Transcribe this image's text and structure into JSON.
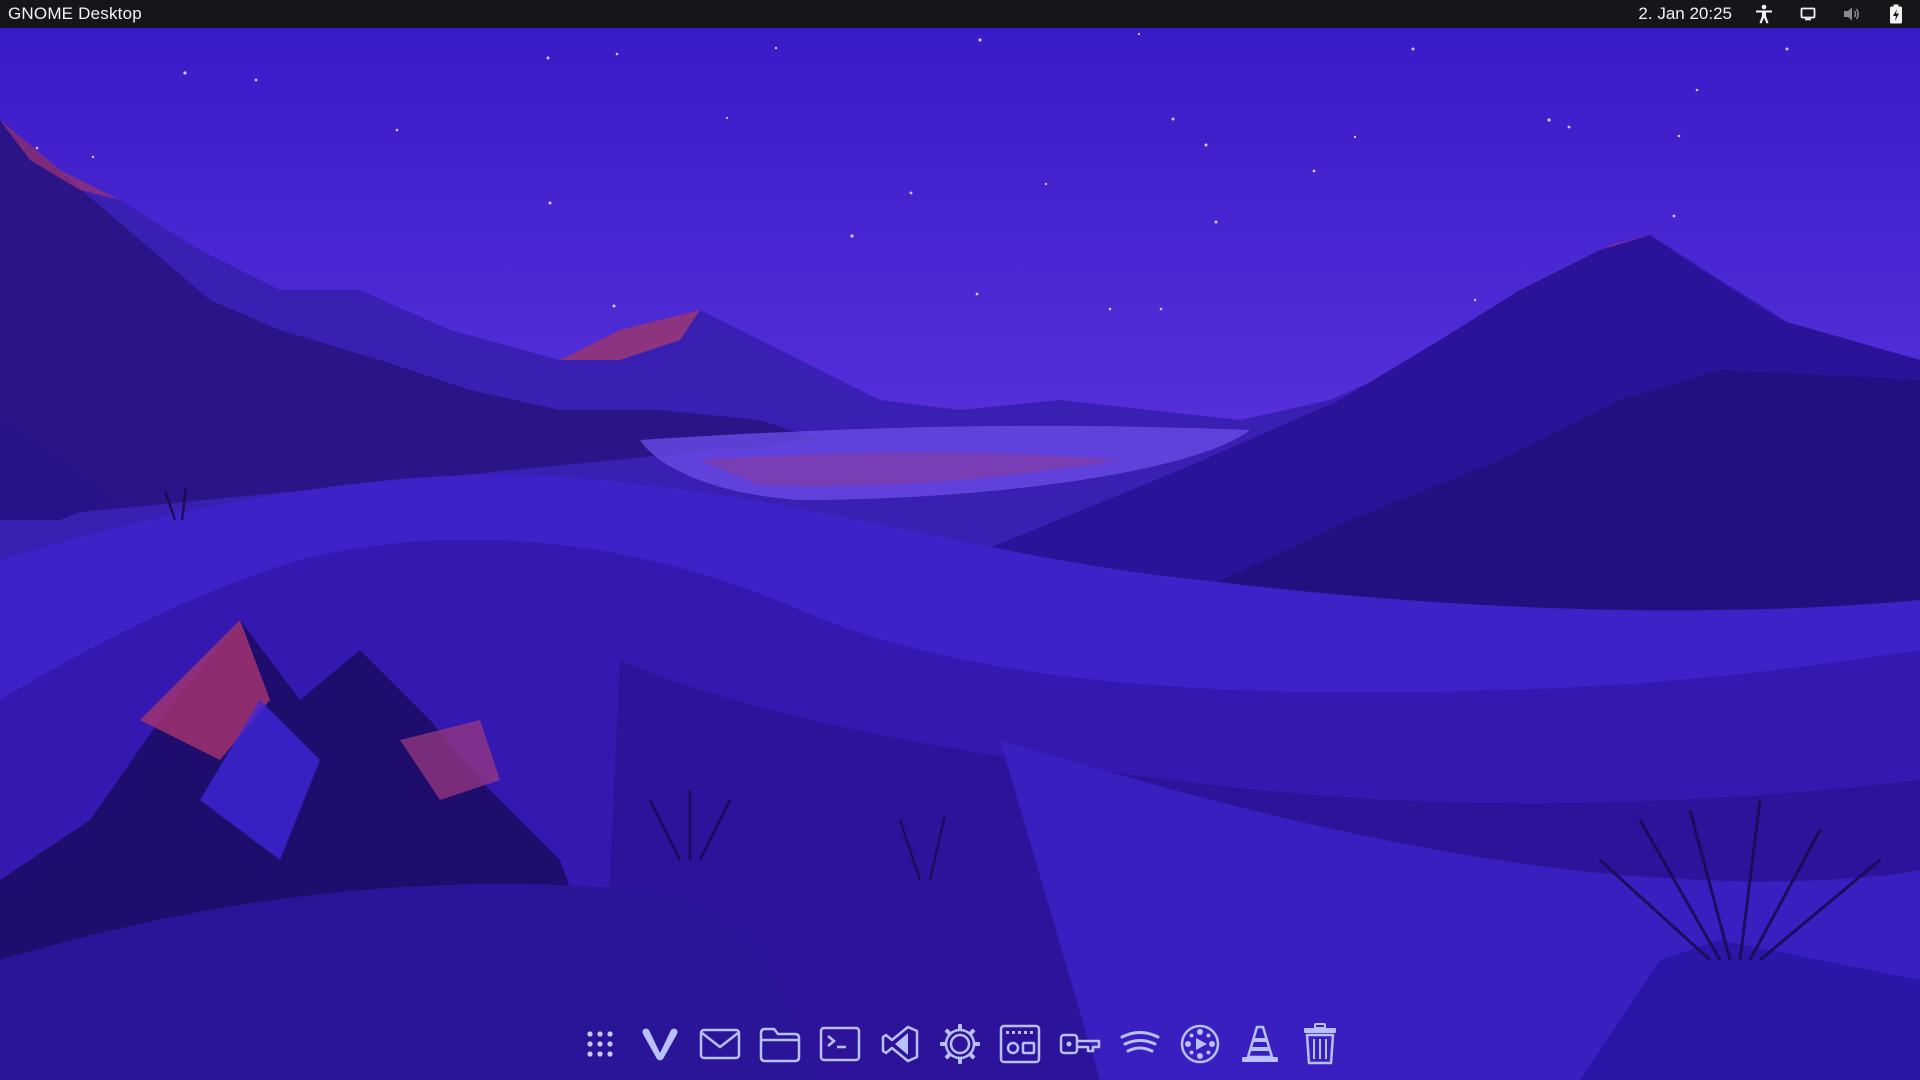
{
  "topbar": {
    "activities_label": "GNOME Desktop",
    "clock": "2. Jan  20:25",
    "tray_icons": [
      "accessibility-icon",
      "screen-icon",
      "volume-icon",
      "battery-icon"
    ]
  },
  "dock": {
    "items": [
      {
        "name": "show-apps",
        "icon": "app-grid-icon"
      },
      {
        "name": "vivaldi",
        "icon": "vivaldi-icon"
      },
      {
        "name": "mail",
        "icon": "mail-icon"
      },
      {
        "name": "files",
        "icon": "folder-icon"
      },
      {
        "name": "terminal",
        "icon": "terminal-icon"
      },
      {
        "name": "vscode",
        "icon": "vscode-icon"
      },
      {
        "name": "settings",
        "icon": "gear-icon"
      },
      {
        "name": "software",
        "icon": "software-store-icon"
      },
      {
        "name": "passwords",
        "icon": "key-icon"
      },
      {
        "name": "spotify",
        "icon": "spotify-icon"
      },
      {
        "name": "media-player",
        "icon": "film-reel-icon"
      },
      {
        "name": "vlc",
        "icon": "vlc-cone-icon"
      },
      {
        "name": "trash",
        "icon": "trash-icon"
      }
    ]
  },
  "colors": {
    "topbar_bg": "#16161a",
    "sky_top": "#3a1ccc",
    "sky_bottom": "#6a3fe0",
    "dock_icon": "#b9c0ff"
  }
}
